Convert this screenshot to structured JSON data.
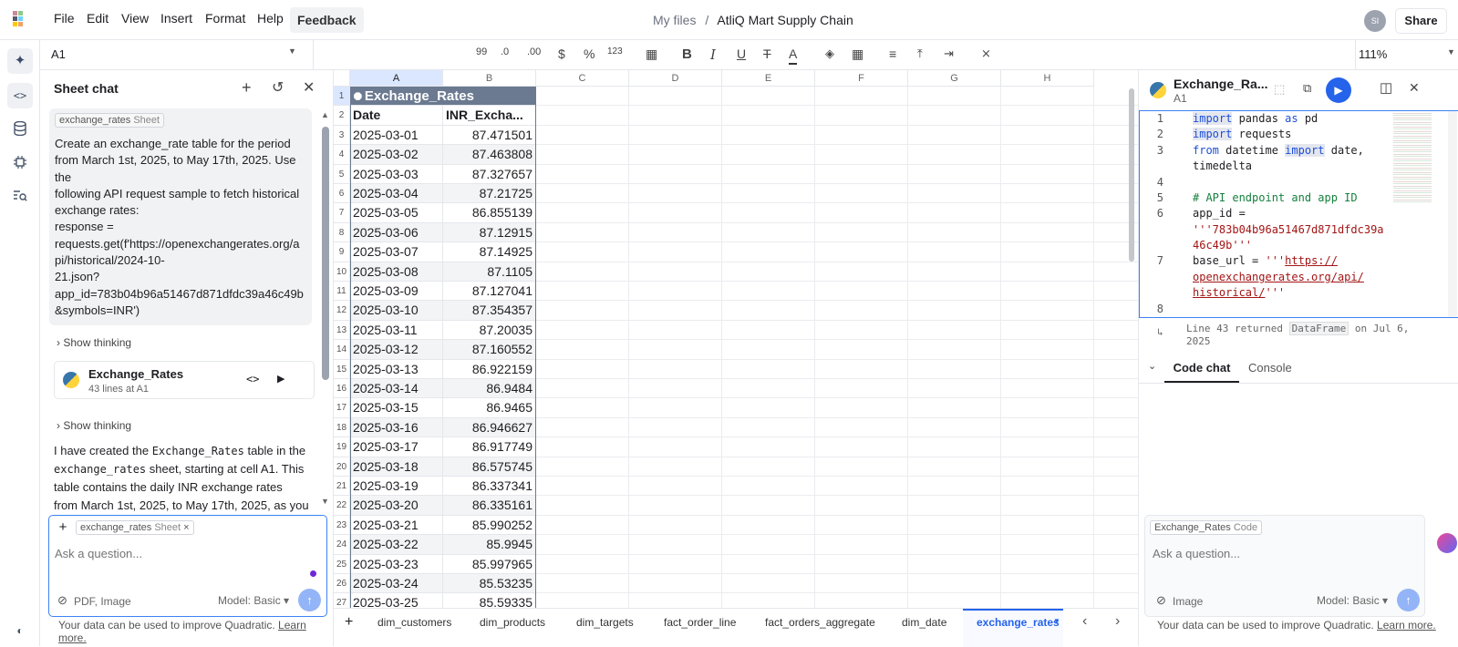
{
  "topbar": {
    "menus": [
      "File",
      "Edit",
      "View",
      "Insert",
      "Format",
      "Help"
    ],
    "feedback": "Feedback",
    "breadcrumb_root": "My files",
    "breadcrumb_sep": "/",
    "file_name": "AtliQ Mart Supply Chain",
    "avatar": "SI",
    "share": "Share"
  },
  "toolbar": {
    "cell_ref": "A1",
    "decimals_label": "99",
    "dec_less": ".0",
    "dec_more": ".00",
    "currency": "$",
    "percent": "%",
    "number": "123",
    "zoom": "111%"
  },
  "sheet_chat": {
    "title": "Sheet chat",
    "context_chip_name": "exchange_rates",
    "context_chip_type": "Sheet",
    "user_message_lines": [
      "Create an exchange_rate table for the period",
      "from March 1st, 2025, to May 17th, 2025. Use",
      "the",
      "following API request sample to fetch historical",
      "exchange rates:",
      "response =",
      "requests.get(f'https://openexchangerates.org/a",
      "pi/historical/2024-10-",
      "21.json?",
      "app_id=783b04b96a51467d871dfdc39a46c49b",
      "&symbols=INR')"
    ],
    "show_thinking": "Show thinking",
    "code_card_title": "Exchange_Rates",
    "code_card_sub": "43 lines at A1",
    "reply_lines": [
      [
        "I have created the ",
        "Exchange_Rates",
        " table in the"
      ],
      [
        "",
        "exchange_rates",
        " sheet, starting at cell A1. This"
      ],
      [
        "table contains the daily INR exchange rates",
        "",
        ""
      ],
      [
        "from March 1st, 2025, to May 17th, 2025, as you",
        "",
        ""
      ]
    ],
    "input_chip_name": "exchange_rates",
    "input_chip_type": "Sheet",
    "input_placeholder": "Ask a question...",
    "attach_label": "PDF, Image",
    "model_label": "Model: Basic",
    "privacy_text": "Your data can be used to improve Quadratic.",
    "privacy_link": "Learn more."
  },
  "grid": {
    "columns": [
      "A",
      "B",
      "C",
      "D",
      "E",
      "F",
      "G",
      "H"
    ],
    "table_name": "Exchange_Rates",
    "headers": [
      "Date",
      "INR_Excha..."
    ],
    "rows": [
      [
        "2025-03-01",
        "87.471501"
      ],
      [
        "2025-03-02",
        "87.463808"
      ],
      [
        "2025-03-03",
        "87.327657"
      ],
      [
        "2025-03-04",
        "87.21725"
      ],
      [
        "2025-03-05",
        "86.855139"
      ],
      [
        "2025-03-06",
        "87.12915"
      ],
      [
        "2025-03-07",
        "87.14925"
      ],
      [
        "2025-03-08",
        "87.1105"
      ],
      [
        "2025-03-09",
        "87.127041"
      ],
      [
        "2025-03-10",
        "87.354357"
      ],
      [
        "2025-03-11",
        "87.20035"
      ],
      [
        "2025-03-12",
        "87.160552"
      ],
      [
        "2025-03-13",
        "86.922159"
      ],
      [
        "2025-03-14",
        "86.9484"
      ],
      [
        "2025-03-15",
        "86.9465"
      ],
      [
        "2025-03-16",
        "86.946627"
      ],
      [
        "2025-03-17",
        "86.917749"
      ],
      [
        "2025-03-18",
        "86.575745"
      ],
      [
        "2025-03-19",
        "86.337341"
      ],
      [
        "2025-03-20",
        "86.335161"
      ],
      [
        "2025-03-21",
        "85.990252"
      ],
      [
        "2025-03-22",
        "85.9945"
      ],
      [
        "2025-03-23",
        "85.997965"
      ],
      [
        "2025-03-24",
        "85.53235"
      ],
      [
        "2025-03-25",
        "85.59335"
      ]
    ]
  },
  "sheet_tabs": {
    "add": "+",
    "tabs": [
      "dim_customers",
      "dim_products",
      "dim_targets",
      "fact_order_line",
      "fact_orders_aggregate",
      "dim_date",
      "exchange_rates"
    ],
    "active": "exchange_rates"
  },
  "code_panel": {
    "title": "Exchange_Ra...",
    "cell": "A1",
    "line_numbers": [
      "1",
      "2",
      "3",
      "",
      "4",
      "5",
      "6",
      "",
      "",
      "7",
      "",
      "",
      "8"
    ],
    "return_info_pre": "Line 43 returned",
    "return_type": "DataFrame",
    "return_info_post": "on Jul 6,",
    "return_year": "2025",
    "tab_code_chat": "Code chat",
    "tab_console": "Console",
    "chip_name": "Exchange_Rates",
    "chip_type": "Code",
    "placeholder": "Ask a question...",
    "attach_label": "Image",
    "model_label": "Model: Basic",
    "privacy_text": "Your data can be used to improve Quadratic.",
    "privacy_link": "Learn more."
  },
  "colors": {
    "accent": "#2563eb",
    "table_header": "#6b7a90",
    "selection": "#dbe7ff"
  }
}
